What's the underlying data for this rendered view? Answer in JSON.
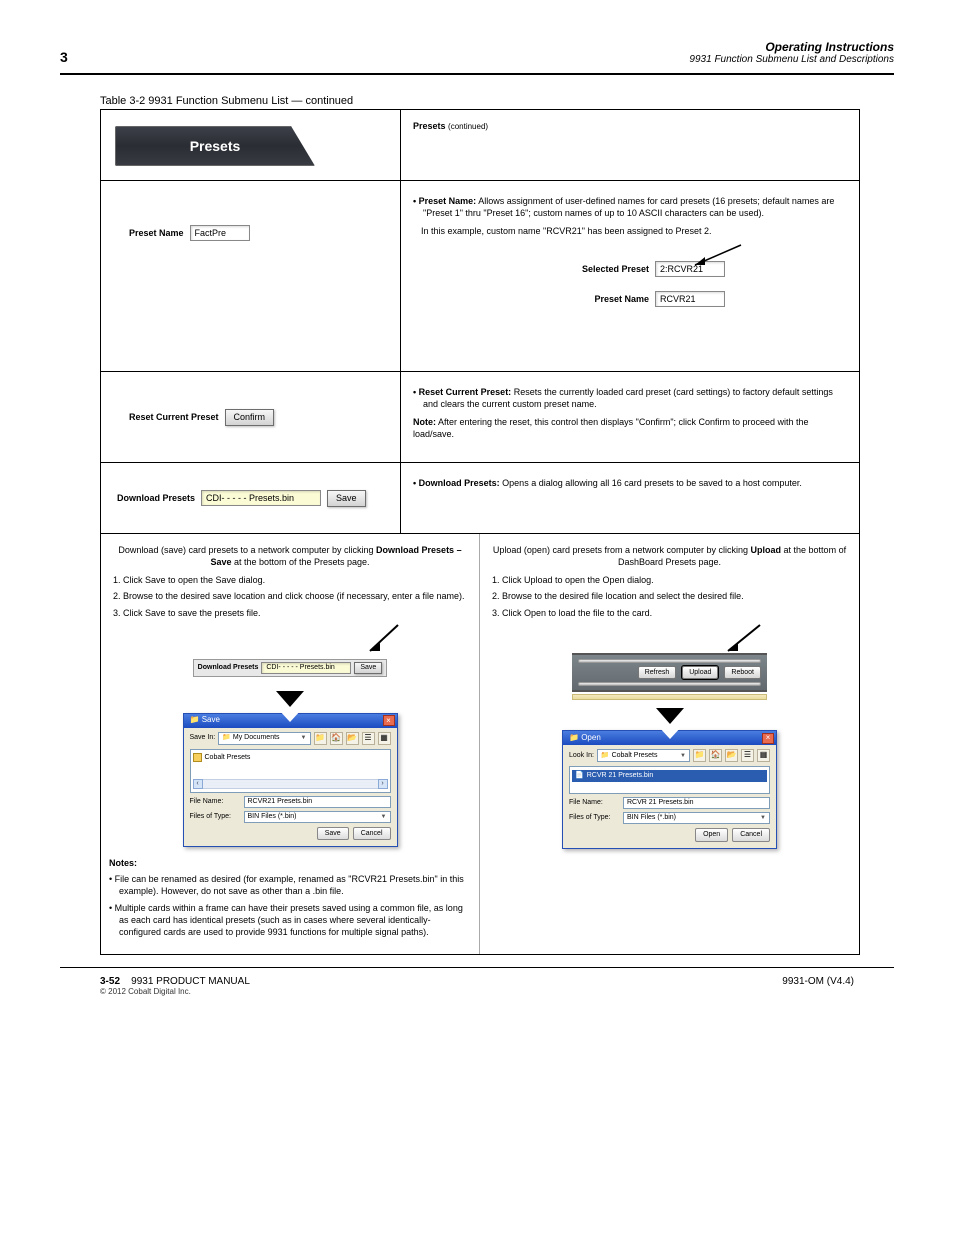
{
  "header": {
    "logo": "3",
    "title": "Operating Instructions",
    "subtitle": "9931 Function Submenu List and Descriptions"
  },
  "table_title": "Table 3-2  9931 Function Submenu List — continued",
  "presets_tab": "Presets",
  "r1": {
    "heading": "(continued)",
    "right_heading": "Presets",
    "bullet_label": "• Preset Name:",
    "bullet_text": " Allows assignment of user-defined names for card presets (16 presets; default names are \"Preset 1\" thru \"Preset 16\"; custom names of up to 10 ASCII characters can be used).",
    "example": "In this example, custom name \"RCVR21\" has been assigned to Preset 2.",
    "widget": {
      "label": "Preset Name",
      "value": "FactPre"
    },
    "sel": {
      "sel_label": "Selected Preset",
      "sel_value": "2:RCVR21",
      "name_label": "Preset Name",
      "name_value": "RCVR21"
    }
  },
  "r2": {
    "widget": {
      "label": "Reset Current Preset",
      "btn": "Confirm"
    },
    "bullet_label": "• Reset Current Preset:",
    "bullet_text": " Resets the currently loaded card preset (card settings) to factory default settings and clears the current custom preset name.",
    "note_label": "Note:",
    "note_text": " After entering the reset, this control then displays \"Confirm\"; click Confirm to proceed with the load/save."
  },
  "r3": {
    "widget": {
      "label": "Download Presets",
      "value": "CDI- - - - -  Presets.bin",
      "btn": "Save"
    },
    "bullet_label": "• Download Presets:",
    "bullet_text": " Opens a dialog allowing all 16 card presets to be saved to a host computer."
  },
  "r4": {
    "heading": "Download (save) card presets to a network computer by clicking Download Presets – Save at the bottom of the Presets page.",
    "l_steps": [
      "Click Save to open the Save dialog.",
      "Browse to the desired save location and click choose (if necessary, enter a file name).",
      "Click Save to save the presets file."
    ],
    "r_heading": "Upload (open) card presets from a network computer by clicking Upload at the bottom of DashBoard Presets page.",
    "r_steps": [
      "Click Upload to open the Open dialog.",
      "Browse to the desired file location and select the desired file.",
      "Click Open to load the file to the card."
    ],
    "dl_widget": {
      "label": "Download Presets",
      "value": "CDI- - - - -  Presets.bin",
      "btn": "Save"
    },
    "bar_btns": {
      "refresh": "Refresh",
      "upload": "Upload",
      "reboot": "Reboot"
    },
    "save_dlg": {
      "title": "Save",
      "where_lbl": "Save In:",
      "where_val": "My Documents",
      "folder": "Cobalt Presets",
      "fname_lbl": "File Name:",
      "fname_val": "RCVR21 Presets.bin",
      "ftype_lbl": "Files of Type:",
      "ftype_val": "BIN Files (*.bin)",
      "save": "Save",
      "cancel": "Cancel"
    },
    "open_dlg": {
      "title": "Open",
      "where_lbl": "Look In:",
      "where_val": "Cobalt Presets",
      "file_item": "RCVR 21 Presets.bin",
      "fname_lbl": "File Name:",
      "fname_val": "RCVR 21 Presets.bin",
      "ftype_lbl": "Files of Type:",
      "ftype_val": "BIN Files (*.bin)",
      "open": "Open",
      "cancel": "Cancel"
    },
    "notes_label": "Notes:",
    "notes": [
      "File can be renamed as desired (for example, renamed as \"RCVR21 Presets.bin\" in this example). However, do not save as other than a .bin file.",
      "Multiple cards within a frame can have their presets saved using a common file, as long as each card has identical presets (such as in cases where several identically-configured cards are used to provide 9931 functions for multiple signal paths)."
    ]
  },
  "footer": {
    "page": "3-52",
    "doc": "9931 PRODUCT MANUAL",
    "credit": "© 2012 Cobalt Digital Inc.",
    "ver": "9931-OM (V4.4)"
  }
}
